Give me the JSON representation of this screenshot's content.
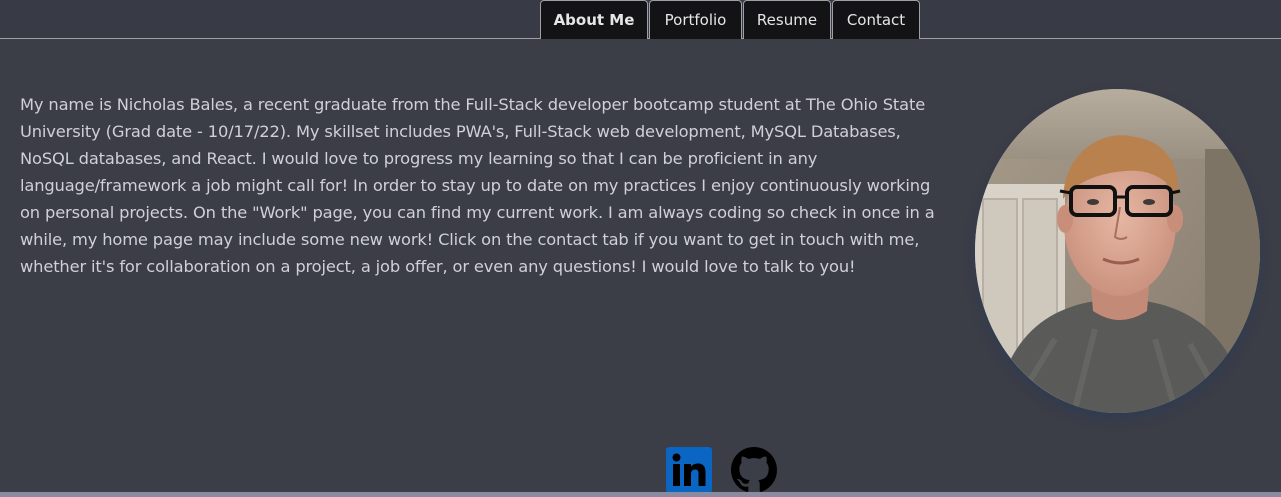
{
  "nav": {
    "tabs": [
      {
        "label": "About Me",
        "active": true
      },
      {
        "label": "Portfolio",
        "active": false
      },
      {
        "label": "Resume",
        "active": false
      },
      {
        "label": "Contact",
        "active": false
      }
    ]
  },
  "about": {
    "bio": "My name is Nicholas Bales, a recent graduate from the Full-Stack developer bootcamp student at The Ohio State University (Grad date - 10/17/22). My skillset includes PWA's, Full-Stack web development, MySQL Databases, NoSQL databases, and React. I would love to progress my learning so that I can be proficient in any language/framework a job might call for! In order to stay up to date on my practices I enjoy continuously working on personal projects. On the \"Work\" page, you can find my current work. I am always coding so check in once in a while, my home page may include some new work! Click on the contact tab if you want to get in touch with me, whether it's for collaboration on a project, a job offer, or even any questions! I would love to talk to you!"
  },
  "social": {
    "icons": [
      "linkedin-icon",
      "github-icon"
    ],
    "linkedin_color": "#0a66c2",
    "github_color": "#000000"
  },
  "colors": {
    "background": "#3b3d47",
    "tab_background": "#131316",
    "text": "#d0d0d6"
  }
}
